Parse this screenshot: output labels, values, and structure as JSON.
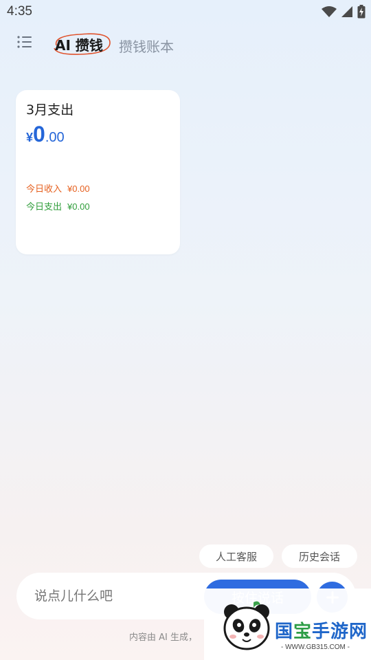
{
  "status": {
    "time": "4:35",
    "icons": [
      "wifi-icon",
      "cellular-signal-icon",
      "battery-charging-icon"
    ]
  },
  "header": {
    "menu_icon": "list-menu-icon",
    "tabs": [
      {
        "label": "AI 攒钱",
        "active": true
      },
      {
        "label": "攒钱账本",
        "active": false
      }
    ]
  },
  "card": {
    "title": "3月支出",
    "currency": "¥",
    "amount_int": "0",
    "amount_dec": ".00",
    "income_label": "今日收入",
    "income_value": "¥0.00",
    "expense_label": "今日支出",
    "expense_value": "¥0.00"
  },
  "chips": {
    "service": "人工客服",
    "history": "历史会话"
  },
  "input": {
    "placeholder": "说点儿什么吧",
    "hold_button": "按住说话",
    "plus_icon": "plus-icon"
  },
  "disclaimer": "内容由 AI 生成，",
  "watermark": {
    "title_a": "国",
    "title_b": "宝",
    "title_c": "手游网",
    "url": "- WWW.GB315.COM -"
  },
  "colors": {
    "accent_blue": "#2f6ce0",
    "amount_blue": "#2566d8",
    "income_orange": "#e6601f",
    "expense_green": "#2f9d3a",
    "circle_red": "#e0522c"
  }
}
